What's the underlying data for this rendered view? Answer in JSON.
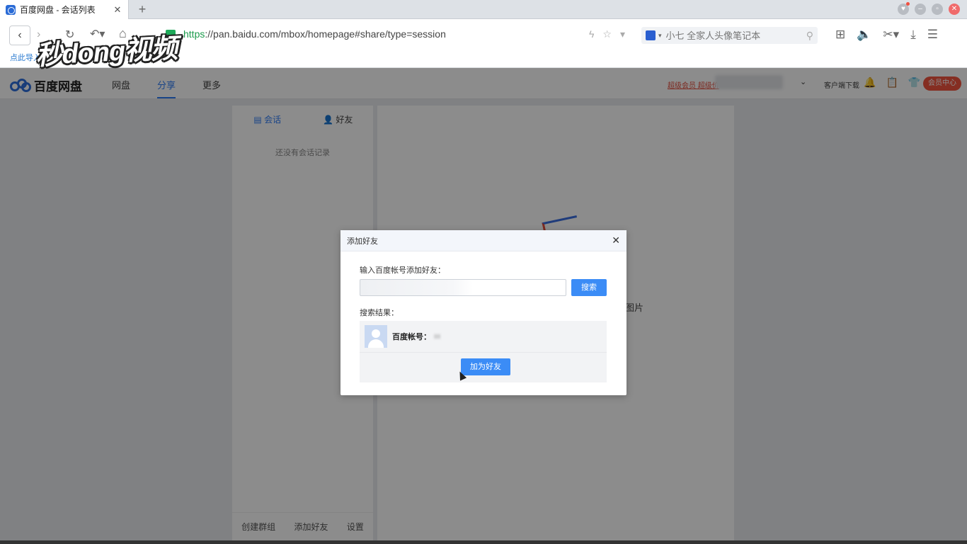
{
  "browser": {
    "tab_title": "百度网盘 - 会话列表",
    "tab_close": "✕",
    "new_tab": "+",
    "url_scheme": "https",
    "url_rest": "://pan.baidu.com/mbox/homepage#share/type=session",
    "search_placeholder": "小七 全家人头像笔记本",
    "bookmark_link": "点此导入",
    "watermark": "秒dong视频"
  },
  "app_header": {
    "logo_text": "百度网盘",
    "nav": [
      "网盘",
      "分享",
      "更多"
    ],
    "active_nav": "分享",
    "vip_link": "超级会员 超级价",
    "client_download": "客户端下载",
    "member_center": "会员中心"
  },
  "left_panel": {
    "tabs": [
      "会话",
      "好友"
    ],
    "active_tab": "会话",
    "empty_text": "还没有会话记录",
    "footer": [
      "创建群组",
      "添加好友",
      "设置"
    ]
  },
  "right_panel": {
    "empty_text_fragment": "图片"
  },
  "modal": {
    "title": "添加好友",
    "close": "✕",
    "input_label": "输入百度帐号添加好友：",
    "input_value": "",
    "search_button": "搜索",
    "results_label": "搜索结果：",
    "account_label": "百度帐号：",
    "account_value": "ııı",
    "add_button": "加为好友"
  },
  "colors": {
    "accent": "#3b8cf6",
    "brand_blue": "#2e6fdc",
    "vip_red": "#f2543f"
  }
}
